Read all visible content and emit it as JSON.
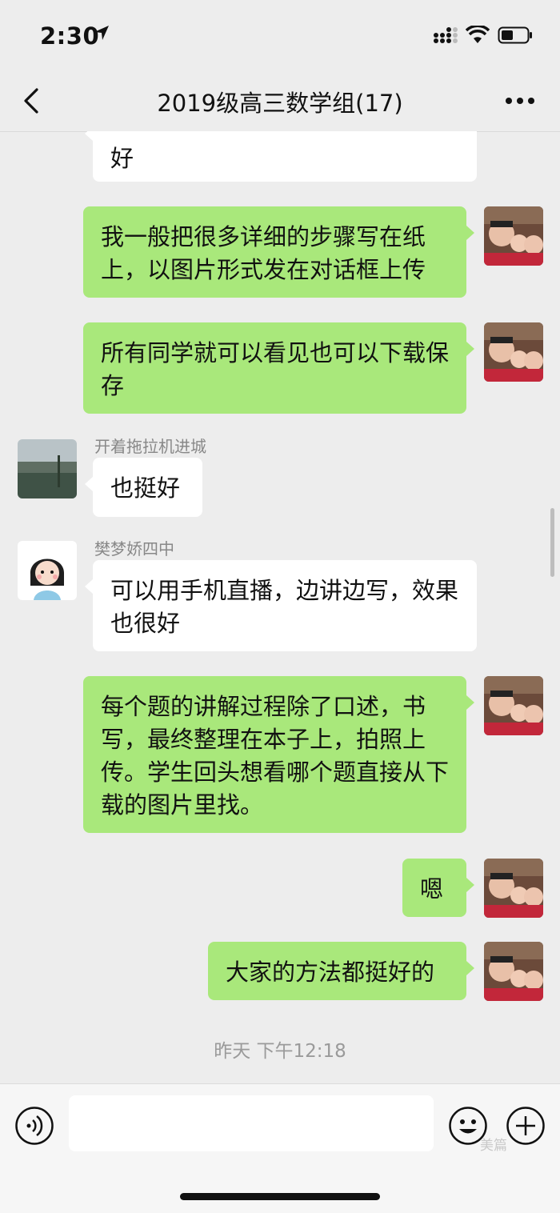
{
  "status_bar": {
    "time": "2:30"
  },
  "nav": {
    "title": "2019级高三数学组(17)"
  },
  "messages": [
    {
      "text": "好"
    },
    {
      "text": "我一般把很多详细的步骤写在纸上，以图片形式发在对话框上传"
    },
    {
      "text": "所有同学就可以看见也可以下载保存"
    },
    {
      "sender": "开着拖拉机进城",
      "text": "也挺好"
    },
    {
      "sender": "樊梦娇四中",
      "text": "可以用手机直播，边讲边写，效果也很好"
    },
    {
      "text": "每个题的讲解过程除了口述，书写，最终整理在本子上，拍照上传。学生回头想看哪个题直接从下载的图片里找。"
    },
    {
      "text": "嗯"
    },
    {
      "text": "大家的方法都挺好的"
    }
  ],
  "timestamp": "昨天 下午12:18",
  "input": {
    "placeholder": ""
  },
  "watermark": "美篇",
  "colors": {
    "self_bubble": "#a9e87b",
    "other_bubble": "#ffffff",
    "background": "#ededed"
  },
  "icons": [
    "location-arrow-icon",
    "signal-icon",
    "wifi-icon",
    "battery-icon",
    "back-chevron-icon",
    "more-dots-icon",
    "voice-icon",
    "emoji-icon",
    "plus-icon"
  ]
}
